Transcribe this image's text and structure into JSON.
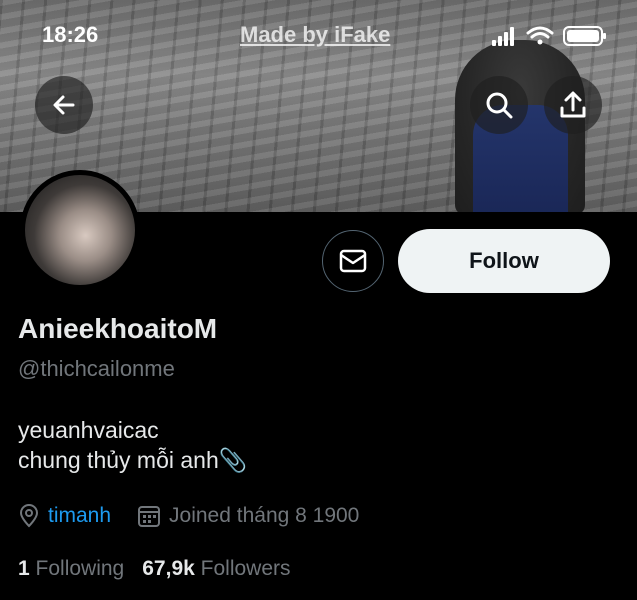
{
  "status_bar": {
    "time": "18:26",
    "watermark": "Made by iFake"
  },
  "header": {
    "back_icon": "arrow-left-icon",
    "search_icon": "search-icon",
    "share_icon": "share-icon"
  },
  "actions": {
    "message_icon": "mail-icon",
    "follow_label": "Follow"
  },
  "profile": {
    "display_name": "AnieekhoaitoM",
    "handle": "@thichcailonme",
    "bio_line1": "yeuanhvaicac",
    "bio_line2": "chung thủy mỗi anh📎",
    "location": "timanh",
    "joined": "Joined tháng 8 1900"
  },
  "stats": {
    "following_count": "1",
    "following_label": "Following",
    "followers_count": "67,9k",
    "followers_label": "Followers"
  },
  "colors": {
    "accent": "#1d9bf0",
    "muted": "#71767b",
    "text": "#e7e9ea",
    "background": "#000000"
  }
}
